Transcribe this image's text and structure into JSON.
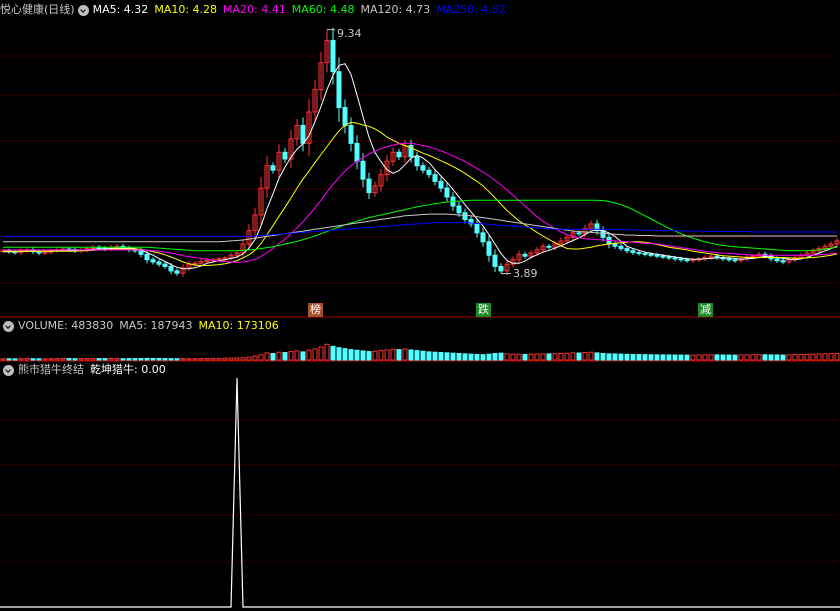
{
  "header": {
    "stock_name": "悦心健康(日线)",
    "ma_items": [
      {
        "label": "MA5: 4.32",
        "color": "#ffffff"
      },
      {
        "label": "MA10: 4.28",
        "color": "#ffff00"
      },
      {
        "label": "MA20: 4.41",
        "color": "#ff00ff"
      },
      {
        "label": "MA60: 4.48",
        "color": "#00ff00"
      },
      {
        "label": "MA120: 4.73",
        "color": "#c8c8c8"
      },
      {
        "label": "MA250: 4.82",
        "color": "#0000ff"
      }
    ]
  },
  "volume_header": {
    "items": [
      {
        "label": "VOLUME: 483830",
        "color": "#c8c8c8"
      },
      {
        "label": "MA5: 187943",
        "color": "#c8c8c8"
      },
      {
        "label": "MA10: 173106",
        "color": "#ffff00"
      }
    ]
  },
  "indicator_header": {
    "items": [
      {
        "label": "熊市猎牛终结",
        "color": "#c8c8c8"
      },
      {
        "label": "乾坤猎牛: 0.00",
        "color": "#ffffff"
      }
    ]
  },
  "annotations": {
    "high_label": "9.34",
    "low_label": "3.89"
  },
  "signal_tags": [
    {
      "text": "榜",
      "bg": "#a8502a",
      "fg": "#ffffff",
      "bar_index": 52
    },
    {
      "text": "跌",
      "bg": "#1e8a2a",
      "fg": "#ffffff",
      "bar_index": 80
    },
    {
      "text": "减",
      "bg": "#1e8a2a",
      "fg": "#ffffff",
      "bar_index": 117
    }
  ],
  "colors": {
    "up": "#ff3232",
    "down": "#54ffff",
    "grid": "#7a0000",
    "pane_border": "#b00000",
    "ma5": "#ffffff",
    "ma10": "#ffff00",
    "ma20": "#ff00ff",
    "ma60": "#00ff00",
    "ma120": "#c8c8c8",
    "ma250": "#0000ff",
    "indicator": "#ffffff"
  },
  "chart_data": {
    "type": "candlestick",
    "price_ylim": [
      3.3,
      9.6
    ],
    "high": 9.34,
    "low": 3.89,
    "closes": [
      4.4,
      4.38,
      4.36,
      4.4,
      4.42,
      4.38,
      4.35,
      4.37,
      4.4,
      4.42,
      4.44,
      4.43,
      4.4,
      4.42,
      4.45,
      4.48,
      4.46,
      4.44,
      4.48,
      4.5,
      4.46,
      4.42,
      4.4,
      4.32,
      4.2,
      4.15,
      4.1,
      4.05,
      3.95,
      3.9,
      4.02,
      4.1,
      4.12,
      4.16,
      4.18,
      4.2,
      4.22,
      4.24,
      4.3,
      4.35,
      4.55,
      4.85,
      5.2,
      5.8,
      6.3,
      6.2,
      6.6,
      6.45,
      6.9,
      7.2,
      6.8,
      7.5,
      8.0,
      8.6,
      9.1,
      8.4,
      7.6,
      7.2,
      6.8,
      6.4,
      6.0,
      5.7,
      5.85,
      6.1,
      6.4,
      6.6,
      6.5,
      6.75,
      6.5,
      6.3,
      6.2,
      6.1,
      5.95,
      5.8,
      5.6,
      5.4,
      5.25,
      5.1,
      5.0,
      4.8,
      4.6,
      4.3,
      4.05,
      3.95,
      4.1,
      4.2,
      4.32,
      4.28,
      4.35,
      4.42,
      4.5,
      4.48,
      4.55,
      4.62,
      4.7,
      4.8,
      4.78,
      4.9,
      5.0,
      4.85,
      4.7,
      4.55,
      4.5,
      4.45,
      4.4,
      4.36,
      4.34,
      4.32,
      4.3,
      4.28,
      4.26,
      4.24,
      4.22,
      4.2,
      4.18,
      4.2,
      4.22,
      4.25,
      4.28,
      4.25,
      4.22,
      4.2,
      4.18,
      4.22,
      4.26,
      4.28,
      4.32,
      4.28,
      4.22,
      4.18,
      4.15,
      4.2,
      4.25,
      4.3,
      4.35,
      4.4,
      4.45,
      4.5,
      4.55,
      4.62
    ],
    "ma": {
      "MA5": [
        4.38,
        4.38,
        4.38,
        4.39,
        4.39,
        4.39,
        4.39,
        4.39,
        4.39,
        4.4,
        4.4,
        4.4,
        4.4,
        4.41,
        4.42,
        4.43,
        4.44,
        4.44,
        4.45,
        4.46,
        4.46,
        4.46,
        4.45,
        4.42,
        4.36,
        4.3,
        4.23,
        4.16,
        4.09,
        4.03,
        4.0,
        4.0,
        4.02,
        4.06,
        4.12,
        4.15,
        4.18,
        4.2,
        4.23,
        4.26,
        4.33,
        4.46,
        4.65,
        4.95,
        5.34,
        5.67,
        6.02,
        6.27,
        6.49,
        6.67,
        6.79,
        6.97,
        7.28,
        7.62,
        8.0,
        8.32,
        8.54,
        8.58,
        8.34,
        7.88,
        7.4,
        6.94,
        6.59,
        6.39,
        6.21,
        6.13,
        6.19,
        6.32,
        6.47,
        6.53,
        6.47,
        6.37,
        6.21,
        6.07,
        5.93,
        5.77,
        5.6,
        5.43,
        5.27,
        5.11,
        4.95,
        4.76,
        4.55,
        4.34,
        4.18,
        4.12,
        4.12,
        4.17,
        4.25,
        4.31,
        4.37,
        4.41,
        4.46,
        4.51,
        4.57,
        4.63,
        4.69,
        4.76,
        4.84,
        4.87,
        4.85,
        4.8,
        4.72,
        4.61,
        4.5,
        4.45,
        4.41,
        4.37,
        4.34,
        4.32,
        4.3,
        4.28,
        4.26,
        4.24,
        4.22,
        4.21,
        4.21,
        4.22,
        4.23,
        4.24,
        4.24,
        4.24,
        4.23,
        4.21,
        4.22,
        4.23,
        4.25,
        4.27,
        4.26,
        4.25,
        4.23,
        4.21,
        4.2,
        4.22,
        4.25,
        4.3,
        4.35,
        4.4,
        4.45,
        4.5
      ],
      "MA10": [
        4.39,
        4.39,
        4.39,
        4.39,
        4.39,
        4.39,
        4.39,
        4.39,
        4.39,
        4.39,
        4.39,
        4.39,
        4.39,
        4.4,
        4.4,
        4.41,
        4.42,
        4.42,
        4.43,
        4.44,
        4.44,
        4.44,
        4.44,
        4.43,
        4.41,
        4.38,
        4.35,
        4.31,
        4.26,
        4.21,
        4.15,
        4.11,
        4.08,
        4.07,
        4.07,
        4.08,
        4.09,
        4.11,
        4.14,
        4.18,
        4.24,
        4.31,
        4.41,
        4.56,
        4.76,
        4.96,
        5.17,
        5.37,
        5.58,
        5.8,
        6.0,
        6.18,
        6.37,
        6.55,
        6.73,
        6.91,
        7.08,
        7.2,
        7.27,
        7.25,
        7.21,
        7.18,
        7.12,
        7.04,
        6.94,
        6.87,
        6.8,
        6.75,
        6.7,
        6.64,
        6.58,
        6.53,
        6.47,
        6.41,
        6.35,
        6.28,
        6.21,
        6.13,
        6.04,
        5.95,
        5.85,
        5.72,
        5.58,
        5.44,
        5.3,
        5.18,
        5.07,
        4.98,
        4.9,
        4.81,
        4.73,
        4.65,
        4.58,
        4.51,
        4.45,
        4.44,
        4.44,
        4.46,
        4.48,
        4.51,
        4.53,
        4.55,
        4.57,
        4.58,
        4.59,
        4.6,
        4.6,
        4.59,
        4.57,
        4.54,
        4.51,
        4.48,
        4.46,
        4.44,
        4.42,
        4.39,
        4.37,
        4.35,
        4.33,
        4.31,
        4.29,
        4.28,
        4.27,
        4.26,
        4.25,
        4.25,
        4.25,
        4.25,
        4.25,
        4.25,
        4.25,
        4.24,
        4.23,
        4.23,
        4.24,
        4.25,
        4.26,
        4.28,
        4.3,
        4.33
      ],
      "MA20": [
        4.42,
        4.42,
        4.42,
        4.42,
        4.42,
        4.42,
        4.42,
        4.42,
        4.42,
        4.42,
        4.42,
        4.42,
        4.42,
        4.42,
        4.42,
        4.42,
        4.42,
        4.42,
        4.42,
        4.42,
        4.42,
        4.42,
        4.42,
        4.42,
        4.41,
        4.4,
        4.39,
        4.37,
        4.35,
        4.32,
        4.29,
        4.27,
        4.25,
        4.23,
        4.21,
        4.19,
        4.17,
        4.16,
        4.15,
        4.14,
        4.15,
        4.17,
        4.21,
        4.27,
        4.36,
        4.46,
        4.56,
        4.66,
        4.78,
        4.91,
        5.05,
        5.2,
        5.36,
        5.53,
        5.71,
        5.88,
        6.04,
        6.18,
        6.3,
        6.4,
        6.48,
        6.56,
        6.63,
        6.68,
        6.72,
        6.76,
        6.79,
        6.8,
        6.8,
        6.78,
        6.75,
        6.72,
        6.68,
        6.63,
        6.58,
        6.52,
        6.46,
        6.39,
        6.32,
        6.24,
        6.16,
        6.07,
        5.97,
        5.87,
        5.76,
        5.64,
        5.52,
        5.4,
        5.28,
        5.16,
        5.06,
        4.97,
        4.89,
        4.82,
        4.76,
        4.72,
        4.69,
        4.67,
        4.66,
        4.65,
        4.64,
        4.63,
        4.62,
        4.61,
        4.6,
        4.59,
        4.58,
        4.57,
        4.56,
        4.55,
        4.53,
        4.51,
        4.49,
        4.47,
        4.45,
        4.43,
        4.41,
        4.39,
        4.37,
        4.36,
        4.35,
        4.34,
        4.33,
        4.32,
        4.31,
        4.3,
        4.3,
        4.3,
        4.3,
        4.3,
        4.3,
        4.3,
        4.3,
        4.3,
        4.3,
        4.3,
        4.31,
        4.32,
        4.33,
        4.35
      ],
      "MA60": [
        4.48,
        4.48,
        4.48,
        4.48,
        4.48,
        4.48,
        4.48,
        4.48,
        4.48,
        4.48,
        4.48,
        4.48,
        4.48,
        4.48,
        4.48,
        4.48,
        4.48,
        4.48,
        4.48,
        4.48,
        4.48,
        4.48,
        4.48,
        4.48,
        4.48,
        4.47,
        4.46,
        4.45,
        4.44,
        4.43,
        4.42,
        4.41,
        4.4,
        4.4,
        4.4,
        4.4,
        4.4,
        4.4,
        4.4,
        4.4,
        4.41,
        4.42,
        4.43,
        4.45,
        4.47,
        4.49,
        4.52,
        4.55,
        4.58,
        4.61,
        4.65,
        4.69,
        4.73,
        4.78,
        4.83,
        4.88,
        4.93,
        4.98,
        5.02,
        5.06,
        5.1,
        5.14,
        5.17,
        5.2,
        5.23,
        5.26,
        5.29,
        5.32,
        5.35,
        5.38,
        5.41,
        5.43,
        5.45,
        5.47,
        5.49,
        5.5,
        5.51,
        5.52,
        5.53,
        5.53,
        5.53,
        5.53,
        5.53,
        5.53,
        5.53,
        5.53,
        5.53,
        5.53,
        5.53,
        5.53,
        5.53,
        5.53,
        5.53,
        5.53,
        5.53,
        5.53,
        5.53,
        5.53,
        5.53,
        5.53,
        5.52,
        5.5,
        5.47,
        5.43,
        5.38,
        5.32,
        5.25,
        5.18,
        5.11,
        5.04,
        4.97,
        4.9,
        4.84,
        4.78,
        4.73,
        4.68,
        4.64,
        4.6,
        4.57,
        4.54,
        4.52,
        4.5,
        4.49,
        4.48,
        4.47,
        4.46,
        4.45,
        4.44,
        4.43,
        4.42,
        4.41,
        4.4,
        4.4,
        4.4,
        4.4,
        4.41,
        4.42,
        4.44,
        4.46,
        4.48
      ],
      "MA120": [
        4.6,
        4.6,
        4.6,
        4.6,
        4.6,
        4.6,
        4.6,
        4.6,
        4.6,
        4.6,
        4.6,
        4.6,
        4.6,
        4.6,
        4.6,
        4.6,
        4.6,
        4.6,
        4.6,
        4.6,
        4.6,
        4.6,
        4.6,
        4.6,
        4.6,
        4.6,
        4.6,
        4.6,
        4.6,
        4.6,
        4.6,
        4.6,
        4.6,
        4.6,
        4.6,
        4.6,
        4.6,
        4.61,
        4.62,
        4.63,
        4.64,
        4.66,
        4.68,
        4.7,
        4.72,
        4.74,
        4.76,
        4.78,
        4.8,
        4.82,
        4.84,
        4.86,
        4.88,
        4.9,
        4.92,
        4.94,
        4.96,
        4.98,
        5.0,
        5.02,
        5.04,
        5.06,
        5.08,
        5.1,
        5.12,
        5.14,
        5.16,
        5.18,
        5.19,
        5.2,
        5.21,
        5.22,
        5.22,
        5.22,
        5.22,
        5.21,
        5.2,
        5.19,
        5.18,
        5.16,
        5.14,
        5.12,
        5.1,
        5.08,
        5.06,
        5.04,
        5.02,
        5.0,
        4.98,
        4.96,
        4.94,
        4.92,
        4.9,
        4.88,
        4.86,
        4.84,
        4.83,
        4.82,
        4.81,
        4.8,
        4.79,
        4.78,
        4.77,
        4.76,
        4.75,
        4.75,
        4.74,
        4.74,
        4.74,
        4.73,
        4.73,
        4.73,
        4.73,
        4.73,
        4.73,
        4.73,
        4.73,
        4.73,
        4.73,
        4.73,
        4.73,
        4.73,
        4.73,
        4.73,
        4.73,
        4.73,
        4.73,
        4.73,
        4.73,
        4.73,
        4.73,
        4.73,
        4.73,
        4.73,
        4.73,
        4.73,
        4.73,
        4.73,
        4.73,
        4.73
      ],
      "MA250": [
        4.72,
        4.72,
        4.72,
        4.72,
        4.72,
        4.72,
        4.72,
        4.72,
        4.72,
        4.72,
        4.72,
        4.72,
        4.72,
        4.72,
        4.72,
        4.72,
        4.72,
        4.72,
        4.72,
        4.72,
        4.72,
        4.72,
        4.72,
        4.72,
        4.72,
        4.72,
        4.72,
        4.72,
        4.72,
        4.72,
        4.72,
        4.72,
        4.72,
        4.72,
        4.72,
        4.72,
        4.72,
        4.72,
        4.72,
        4.72,
        4.72,
        4.72,
        4.73,
        4.74,
        4.75,
        4.76,
        4.77,
        4.78,
        4.79,
        4.8,
        4.81,
        4.82,
        4.83,
        4.84,
        4.85,
        4.86,
        4.87,
        4.88,
        4.89,
        4.9,
        4.91,
        4.92,
        4.93,
        4.94,
        4.95,
        4.96,
        4.97,
        4.98,
        4.99,
        5.0,
        5.01,
        5.02,
        5.03,
        5.03,
        5.03,
        5.03,
        5.03,
        5.03,
        5.02,
        5.01,
        5.0,
        4.99,
        4.98,
        4.97,
        4.96,
        4.95,
        4.94,
        4.93,
        4.92,
        4.91,
        4.9,
        4.89,
        4.88,
        4.88,
        4.88,
        4.88,
        4.88,
        4.88,
        4.88,
        4.88,
        4.88,
        4.88,
        4.88,
        4.88,
        4.87,
        4.87,
        4.86,
        4.86,
        4.86,
        4.85,
        4.85,
        4.85,
        4.85,
        4.84,
        4.84,
        4.84,
        4.84,
        4.84,
        4.83,
        4.83,
        4.83,
        4.83,
        4.83,
        4.83,
        4.83,
        4.82,
        4.82,
        4.82,
        4.82,
        4.82,
        4.82,
        4.82,
        4.82,
        4.82,
        4.82,
        4.82,
        4.82,
        4.82,
        4.82,
        4.82
      ]
    },
    "volume": [
      40,
      38,
      35,
      42,
      45,
      40,
      36,
      38,
      40,
      42,
      45,
      44,
      40,
      42,
      46,
      48,
      44,
      42,
      46,
      48,
      40,
      44,
      42,
      45,
      50,
      48,
      46,
      44,
      42,
      40,
      38,
      40,
      42,
      44,
      46,
      48,
      50,
      55,
      60,
      65,
      70,
      90,
      120,
      160,
      220,
      200,
      240,
      230,
      260,
      280,
      250,
      300,
      340,
      400,
      483,
      420,
      380,
      350,
      320,
      300,
      280,
      260,
      270,
      290,
      310,
      330,
      320,
      340,
      310,
      290,
      270,
      250,
      240,
      230,
      220,
      210,
      200,
      190,
      180,
      170,
      165,
      180,
      200,
      210,
      190,
      180,
      175,
      170,
      178,
      185,
      190,
      188,
      195,
      200,
      210,
      220,
      215,
      230,
      240,
      220,
      200,
      190,
      185,
      180,
      175,
      170,
      168,
      165,
      162,
      160,
      158,
      156,
      154,
      152,
      150,
      152,
      155,
      158,
      160,
      158,
      155,
      152,
      150,
      155,
      160,
      162,
      165,
      162,
      158,
      155,
      152,
      158,
      165,
      170,
      175,
      180,
      185,
      190,
      195,
      200
    ],
    "volume_ylim": [
      0,
      800
    ],
    "indicator": {
      "name": "乾坤猎牛",
      "signal_bar_index": 39,
      "signal_value": 1,
      "last_value": 0.0,
      "ylim": [
        0,
        1
      ]
    }
  }
}
